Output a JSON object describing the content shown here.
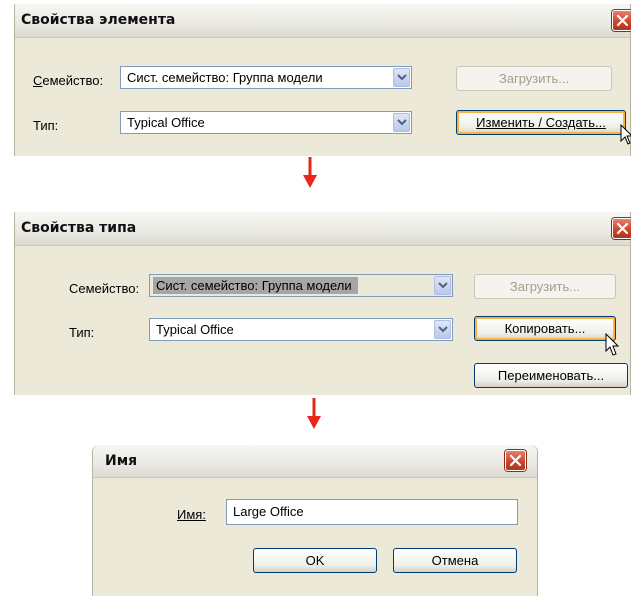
{
  "element_properties": {
    "title": "Свойства элемента",
    "family_label": "Семейство:",
    "family_value": "Сист. семейство: Группа модели",
    "type_label": "Тип:",
    "type_value": "Typical Office",
    "load_button": "Загрузить...",
    "edit_create_button": "Изменить / Создать..."
  },
  "type_properties": {
    "title": "Свойства типа",
    "family_label": "Семейство:",
    "family_value": "Сист. семейство: Группа модели",
    "type_label": "Тип:",
    "type_value": "Typical Office",
    "load_button": "Загрузить...",
    "copy_button": "Копировать...",
    "rename_button": "Переименовать..."
  },
  "name_dialog": {
    "title": "Имя",
    "name_label": "Имя:",
    "name_value": "Large Office",
    "ok_button": "OK",
    "cancel_button": "Отмена"
  },
  "colors": {
    "flow_arrow": "#e8261c",
    "close_button": "#c8432b"
  },
  "icons": [
    "close-icon",
    "chevron-down-icon",
    "arrow-down-icon",
    "mouse-cursor-icon"
  ]
}
